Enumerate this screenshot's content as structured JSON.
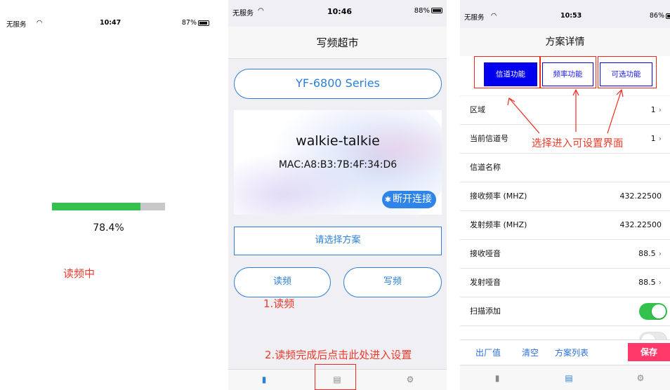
{
  "screen1": {
    "status": {
      "carrier": "无服务",
      "time": "10:47",
      "battery": "87%"
    },
    "progress": {
      "percent": 78.4,
      "label": "78.4%"
    },
    "annotation": "读频中"
  },
  "screen2": {
    "status": {
      "carrier": "无服务",
      "time": "10:46",
      "battery": "88%"
    },
    "title": "写频超市",
    "series_button": "YF-6800 Series",
    "device": {
      "name": "walkie-talkie",
      "mac": "MAC:A8:B3:7B:4F:34:D6",
      "disconnect": "断开连接"
    },
    "scheme_button": "请选择方案",
    "read_button": "读频",
    "write_button": "写频",
    "annotation1": "1.读频",
    "annotation2": "2.读频完成后点击此处进入设置"
  },
  "screen3": {
    "status": {
      "carrier": "无服务",
      "time": "10:53",
      "battery": "86%"
    },
    "title": "方案详情",
    "tabs": [
      "信道功能",
      "频率功能",
      "可选功能"
    ],
    "rows": [
      {
        "label": "区域",
        "value": "1"
      },
      {
        "label": "当前信道号",
        "value": "1"
      },
      {
        "label": "信道名称",
        "value": ""
      },
      {
        "label": "接收频率 (MHZ)",
        "value": "432.22500"
      },
      {
        "label": "发射频率 (MHZ)",
        "value": "432.22500"
      },
      {
        "label": "接收哑音",
        "value": "88.5"
      },
      {
        "label": "发射哑音",
        "value": "88.5"
      },
      {
        "label": "扫描添加",
        "value": ""
      }
    ],
    "annotation": "选择进入可设置界面",
    "bottom": {
      "factory": "出厂值",
      "clear": "清空",
      "list": "方案列表",
      "save": "保存"
    }
  },
  "colors": {
    "accent_blue": "#2d7fd8",
    "annotation_red": "#ee3b2b",
    "progress_green": "#33c24d",
    "tab_active": "#0000ee",
    "save_pink": "#ff3a6a"
  }
}
